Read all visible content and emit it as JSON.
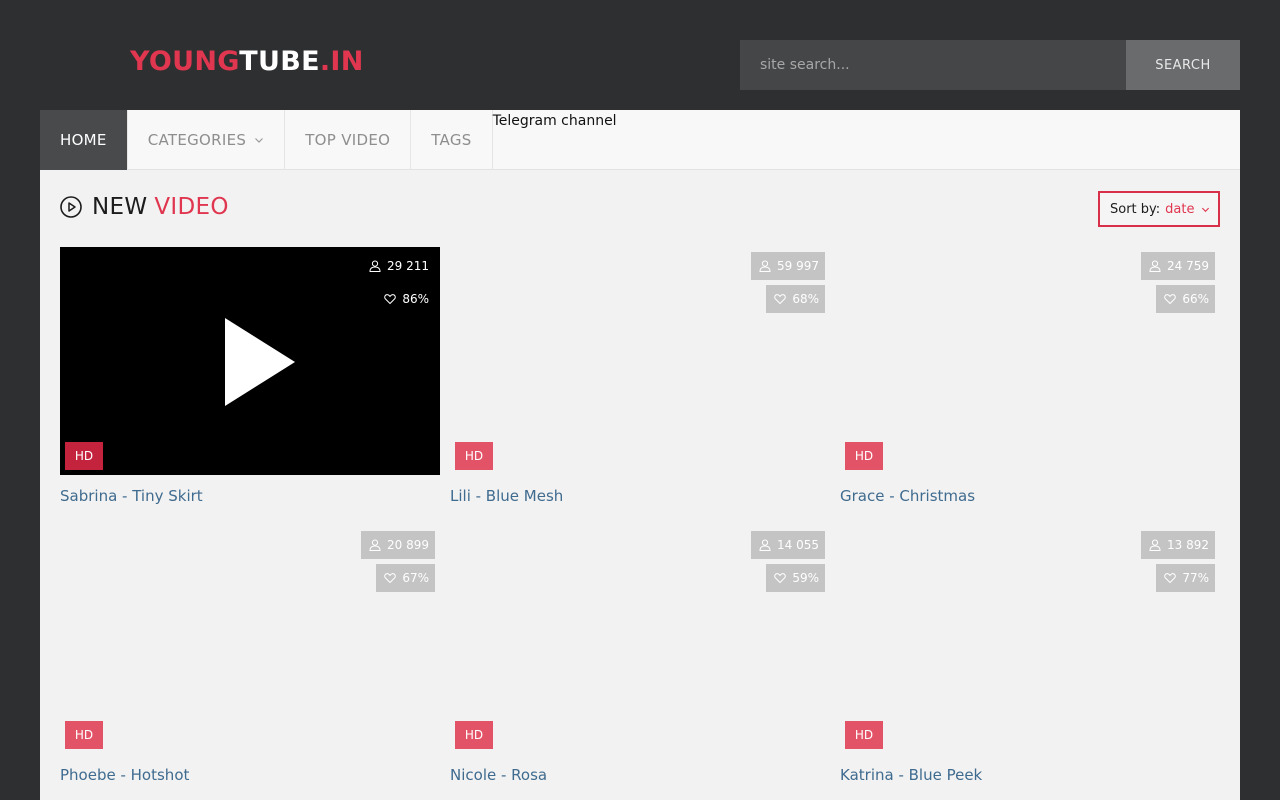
{
  "logo": {
    "part1": "YOUNG",
    "part2": "TUBE",
    "part3": ".IN"
  },
  "search": {
    "placeholder": "site search...",
    "button_label": "SEARCH"
  },
  "nav": {
    "items": [
      {
        "label": "HOME",
        "active": true
      },
      {
        "label": "CATEGORIES",
        "has_dropdown": true
      },
      {
        "label": "TOP VIDEO"
      },
      {
        "label": "TAGS"
      }
    ],
    "telegram": "Telegram channel"
  },
  "section": {
    "title_part1": "NEW",
    "title_part2": "VIDEO",
    "icon": "play-circle-icon"
  },
  "sort": {
    "label": "Sort by:",
    "value": "date"
  },
  "videos": [
    {
      "title": "Sabrina - Tiny Skirt",
      "views": "29 211",
      "rating": "86%",
      "quality": "HD"
    },
    {
      "title": "Lili - Blue Mesh",
      "views": "59 997",
      "rating": "68%",
      "quality": "HD"
    },
    {
      "title": "Grace - Christmas",
      "views": "24 759",
      "rating": "66%",
      "quality": "HD"
    },
    {
      "title": "Phoebe - Hotshot",
      "views": "20 899",
      "rating": "67%",
      "quality": "HD"
    },
    {
      "title": "Nicole - Rosa",
      "views": "14 055",
      "rating": "59%",
      "quality": "HD"
    },
    {
      "title": "Katrina - Blue Peek",
      "views": "13 892",
      "rating": "77%",
      "quality": "HD"
    }
  ],
  "colors": {
    "accent": "#e0364f",
    "background": "#2e2f31",
    "link": "#3f6b8f",
    "nav_active": "#484a4c"
  }
}
